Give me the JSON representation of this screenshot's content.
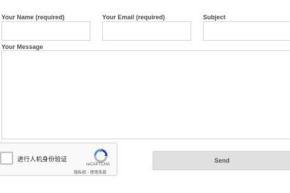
{
  "form": {
    "name": {
      "label": "Your Name (required)",
      "value": ""
    },
    "email": {
      "label": "Your Email (required)",
      "value": ""
    },
    "subject": {
      "label": "Subject",
      "value": ""
    },
    "message": {
      "label": "Your Message",
      "value": ""
    },
    "send_label": "Send"
  },
  "captcha": {
    "checkbox_text": "进行人机身份验证",
    "brand": "reCAPTCHA",
    "privacy_link": "隐私权",
    "separator": " - ",
    "terms_link": "使用条款",
    "checked": false,
    "logo_icon": "recaptcha-logo-icon",
    "colors": {
      "arrow_blue": "#1c3aa9",
      "arrow_light_blue": "#4a90e2",
      "arrow_gray": "#b3b3b3"
    }
  }
}
